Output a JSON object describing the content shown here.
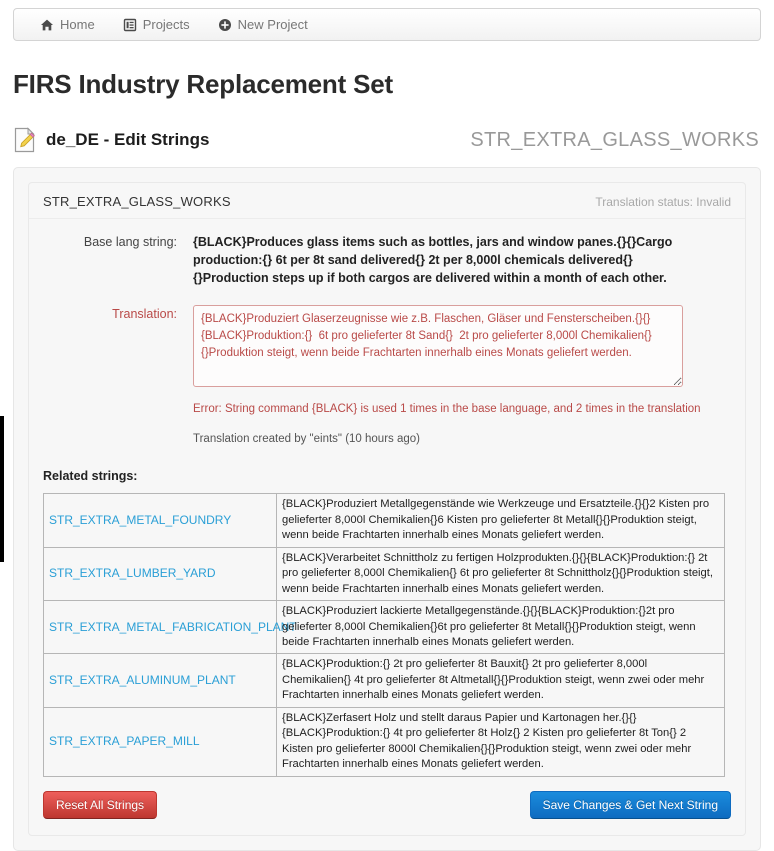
{
  "navbar": {
    "items": [
      {
        "label": "Home",
        "icon": "home-icon"
      },
      {
        "label": "Projects",
        "icon": "list-icon"
      },
      {
        "label": "New Project",
        "icon": "plus-circle-icon"
      }
    ]
  },
  "page_title": "FIRS Industry Replacement Set",
  "section": {
    "icon": "edit-document-icon",
    "title": "de_DE - Edit Strings",
    "string_name": "STR_EXTRA_GLASS_WORKS"
  },
  "panel": {
    "header_title": "STR_EXTRA_GLASS_WORKS",
    "status": "Translation status: Invalid"
  },
  "form": {
    "base_label": "Base lang string:",
    "base_value": "{BLACK}Produces glass items such as bottles, jars and window panes.{}{}Cargo production:{} 6t per 8t sand delivered{} 2t per 8,000l chemicals delivered{}{}Production steps up if both cargos are delivered within a month of each other.",
    "translation_label": "Translation:",
    "translation_value": "{BLACK}Produziert Glaserzeugnisse wie z.B. Flaschen, Gläser und Fensterscheiben.{}{}{BLACK}Produktion:{}  6t pro gelieferter 8t Sand{}  2t pro gelieferter 8,000l Chemikalien{}{}Produktion steigt, wenn beide Frachtarten innerhalb eines Monats geliefert werden.",
    "translation_placeholder": "",
    "error_message": "Error: String command {BLACK} is used 1 times in the base language, and 2 times in the translation",
    "meta_message": "Translation created by \"eints\" (10 hours ago)"
  },
  "related": {
    "heading": "Related strings:",
    "rows": [
      {
        "key": "STR_EXTRA_METAL_FOUNDRY",
        "value": "{BLACK}Produziert Metallgegenstände wie Werkzeuge und Ersatzteile.{}{}2 Kisten pro gelieferter 8,000l Chemikalien{}6 Kisten pro gelieferter 8t Metall{}{}Produktion steigt, wenn beide Frachtarten innerhalb eines Monats geliefert werden."
      },
      {
        "key": "STR_EXTRA_LUMBER_YARD",
        "value": "{BLACK}Verarbeitet Schnittholz zu fertigen Holzprodukten.{}{}{BLACK}Produktion:{} 2t pro gelieferter 8,000l Chemikalien{} 6t pro gelieferter 8t Schnittholz{}{}Produktion steigt, wenn beide Frachtarten innerhalb eines Monats geliefert werden."
      },
      {
        "key": "STR_EXTRA_METAL_FABRICATION_PLANT",
        "value": "{BLACK}Produziert lackierte Metallgegenstände.{}{}{BLACK}Produktion:{}2t pro gelieferter 8,000l Chemikalien{}6t pro gelieferter 8t Metall{}{}Produktion steigt, wenn beide Frachtarten innerhalb eines Monats geliefert werden."
      },
      {
        "key": "STR_EXTRA_ALUMINUM_PLANT",
        "value": "{BLACK}Produktion:{} 2t pro gelieferter 8t Bauxit{} 2t pro gelieferter 8,000l Chemikalien{} 4t pro gelieferter 8t Altmetall{}{}Produktion steigt, wenn zwei oder mehr Frachtarten innerhalb eines Monats geliefert werden."
      },
      {
        "key": "STR_EXTRA_PAPER_MILL",
        "value": "{BLACK}Zerfasert Holz und stellt daraus Papier und Kartonagen her.{}{}{BLACK}Produktion:{} 4t pro gelieferter 8t Holz{} 2 Kisten pro gelieferter 8t Ton{} 2 Kisten pro gelieferter 8000l Chemikalien{}{}Produktion steigt, wenn zwei oder mehr Frachtarten innerhalb eines Monats geliefert werden."
      }
    ]
  },
  "footer": {
    "reset_label": "Reset All Strings",
    "save_label": "Save Changes & Get Next String"
  },
  "colors": {
    "link": "#2a9fd6",
    "error": "#b94a48",
    "primary_button": "#0e6bc0",
    "danger_button": "#bd362f"
  }
}
